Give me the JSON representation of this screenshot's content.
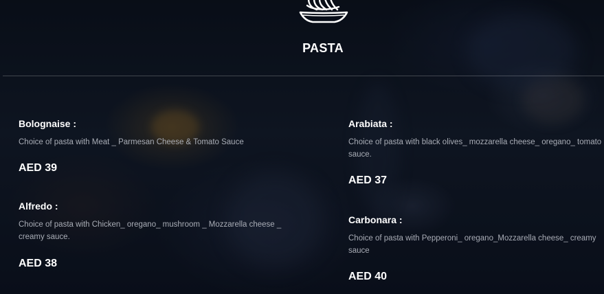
{
  "section": {
    "icon": "spaghetti-plate-icon",
    "title": "PASTA"
  },
  "items": [
    {
      "name": "Bolognaise :",
      "description": "Choice of pasta with Meat _ Parmesan Cheese & Tomato Sauce",
      "price": "AED 39"
    },
    {
      "name": "Alfredo :",
      "description": "Choice of pasta with Chicken_ oregano_ mushroom _ Mozzarella cheese _ creamy sauce.",
      "price": "AED 38"
    },
    {
      "name": "Arabiata :",
      "description": "Choice of pasta with black olives_ mozzarella cheese_ oregano_ tomato sauce.",
      "price": "AED 37"
    },
    {
      "name": "Carbonara :",
      "description": "Choice of pasta with Pepperoni_ oregano_Mozzarella cheese_ creamy sauce",
      "price": "AED 40"
    }
  ],
  "colors": {
    "text": "#ffffff",
    "description": "#a9adb6",
    "background": "#0d1320"
  }
}
